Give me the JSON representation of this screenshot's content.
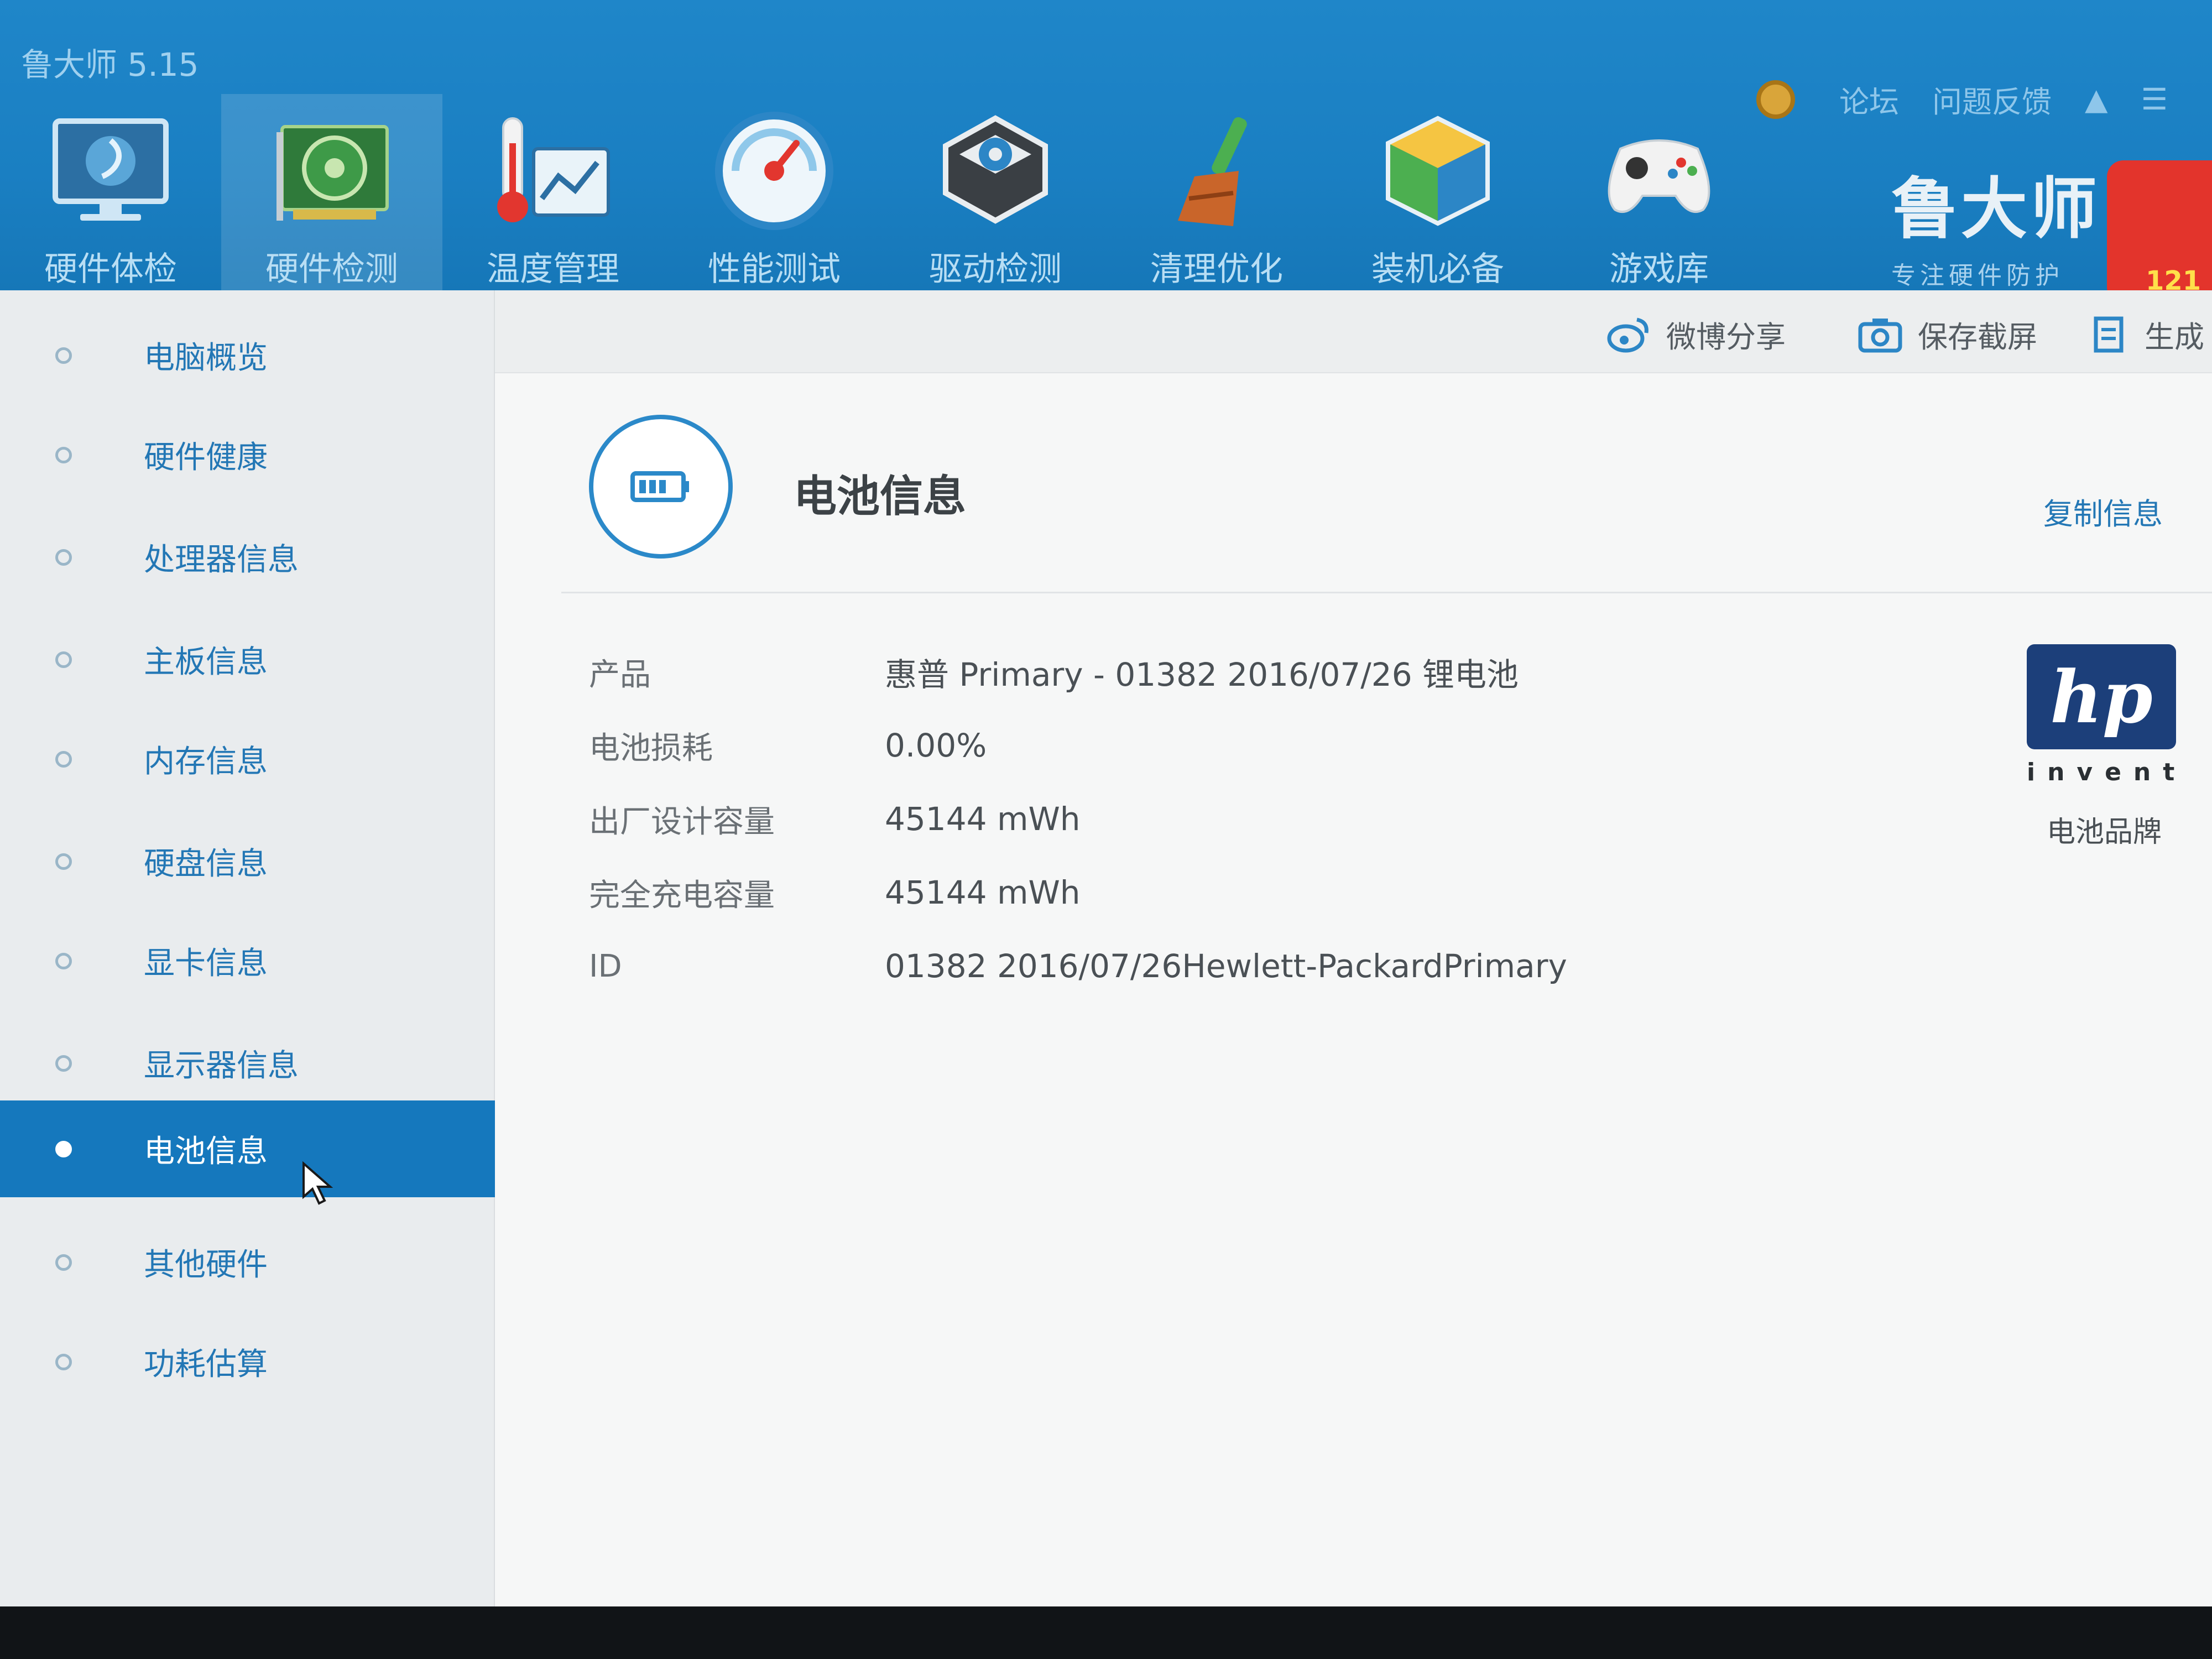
{
  "app": {
    "title": "鲁大师 5.15"
  },
  "top_links": {
    "forum": "论坛",
    "feedback": "问题反馈"
  },
  "nav": [
    {
      "label": "硬件体检",
      "icon": "monitor-icon",
      "active": false
    },
    {
      "label": "硬件检测",
      "icon": "graphics-card-icon",
      "active": true
    },
    {
      "label": "温度管理",
      "icon": "thermometer-chart-icon",
      "active": false
    },
    {
      "label": "性能测试",
      "icon": "speedometer-icon",
      "active": false
    },
    {
      "label": "驱动检测",
      "icon": "gear-box-icon",
      "active": false
    },
    {
      "label": "清理优化",
      "icon": "broom-icon",
      "active": false
    },
    {
      "label": "装机必备",
      "icon": "cube-icon",
      "active": false
    },
    {
      "label": "游戏库",
      "icon": "gamepad-icon",
      "active": false
    }
  ],
  "brand": {
    "name": "鲁大师",
    "tagline": "专注硬件防护",
    "badge": "121"
  },
  "sidebar": [
    {
      "label": "电脑概览",
      "active": false
    },
    {
      "label": "硬件健康",
      "active": false
    },
    {
      "label": "处理器信息",
      "active": false
    },
    {
      "label": "主板信息",
      "active": false
    },
    {
      "label": "内存信息",
      "active": false
    },
    {
      "label": "硬盘信息",
      "active": false
    },
    {
      "label": "显卡信息",
      "active": false
    },
    {
      "label": "显示器信息",
      "active": false
    },
    {
      "label": "电池信息",
      "active": true
    },
    {
      "label": "其他硬件",
      "active": false
    },
    {
      "label": "功耗估算",
      "active": false
    }
  ],
  "toolbar": {
    "weibo_share": "微博分享",
    "save_screenshot": "保存截屏",
    "generate": "生成"
  },
  "section": {
    "title": "电池信息",
    "copy_label": "复制信息"
  },
  "battery_info": [
    {
      "key": "产品",
      "value": "惠普 Primary - 01382 2016/07/26 锂电池"
    },
    {
      "key": "电池损耗",
      "value": "0.00%"
    },
    {
      "key": "出厂设计容量",
      "value": "45144 mWh"
    },
    {
      "key": "完全充电容量",
      "value": "45144 mWh"
    },
    {
      "key": "ID",
      "value": "01382 2016/07/26Hewlett-PackardPrimary"
    }
  ],
  "brand_logo": {
    "text": "hp",
    "subtext": "invent",
    "caption": "电池品牌"
  },
  "colors": {
    "header_blue": "#1a7fc2",
    "accent_blue": "#1578bd",
    "link_blue": "#2377b5"
  }
}
